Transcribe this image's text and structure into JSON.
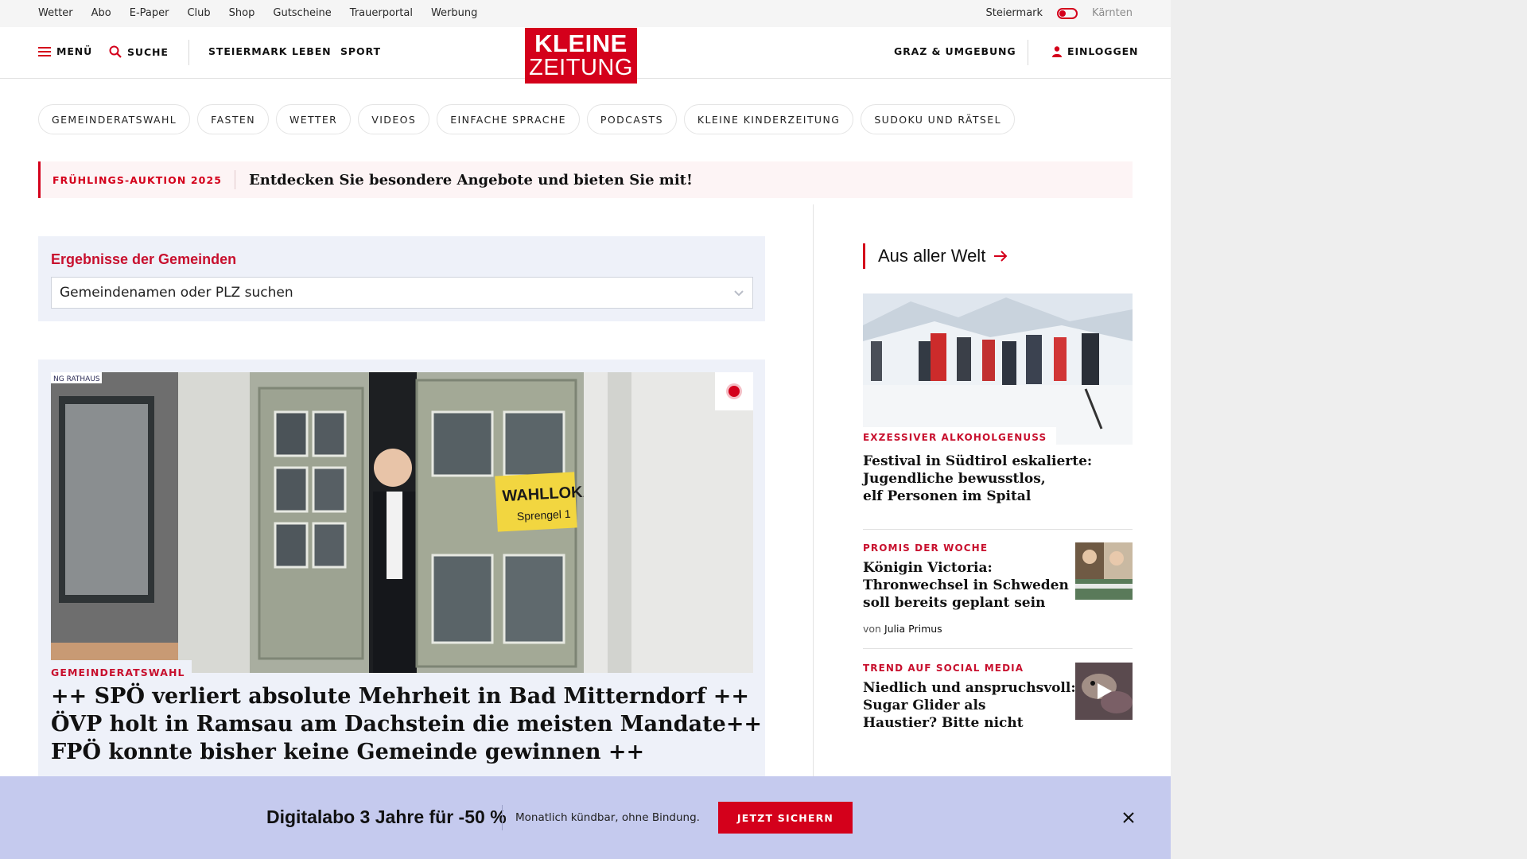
{
  "meta_bar": {
    "links": [
      "Wetter",
      "Abo",
      "E-Paper",
      "Club",
      "Shop",
      "Gutscheine",
      "Trauerportal",
      "Werbung"
    ],
    "region_left": "Steiermark",
    "region_right": "Kärnten"
  },
  "header": {
    "menu_label": "MENÜ",
    "search_label": "SUCHE",
    "nav": [
      "STEIERMARK",
      "LEBEN",
      "SPORT"
    ],
    "logo_line1": "KLEINE",
    "logo_line2": "ZEITUNG",
    "region_link": "GRAZ & UMGEBUNG",
    "login_label": "EINLOGGEN"
  },
  "pills": [
    "GEMEINDERATSWAHL",
    "FASTEN",
    "WETTER",
    "VIDEOS",
    "EINFACHE SPRACHE",
    "PODCASTS",
    "KLEINE KINDERZEITUNG",
    "SUDOKU UND RÄTSEL"
  ],
  "promo": {
    "kicker": "FRÜHLINGS-AUKTION 2025",
    "text": "Entdecken Sie besondere Angebote und bieten Sie mit!"
  },
  "gemeinden": {
    "title": "Ergebnisse der Gemeinden",
    "placeholder": "Gemeindenamen oder PLZ suchen"
  },
  "lead": {
    "image_sign_main": "WAHLLOKAL",
    "image_sign_sub": "Sprengel 1",
    "image_corner_text": "NG RATHAUS",
    "kicker": "GEMEINDERATSWAHL",
    "headline_lines": [
      "++ SPÖ verliert absolute Mehrheit in Bad Mitterndorf ++",
      "ÖVP holt in Ramsau am Dachstein die meisten Mandate++",
      "FPÖ konnte bisher keine Gemeinde gewinnen ++"
    ]
  },
  "sidebar": {
    "section_title": "Aus aller Welt",
    "featured": {
      "kicker": "EXZESSIVER ALKOHOLGENUSS",
      "title_lines": [
        "Festival in Südtirol eskalierte:",
        "Jugendliche bewusstlos,",
        "elf Personen im Spital"
      ]
    },
    "items": [
      {
        "kicker": "PROMIS DER WOCHE",
        "title_lines": [
          "Königin Victoria:",
          "Thronwechsel in Schweden",
          "soll bereits geplant sein"
        ],
        "author_prefix": "von",
        "author": "Julia Primus"
      },
      {
        "kicker": "TREND AUF SOCIAL MEDIA",
        "title_lines": [
          "Niedlich und anspruchsvoll:",
          "Sugar Glider als",
          "Haustier? Bitte nicht"
        ]
      }
    ]
  },
  "subscription": {
    "offer": "Digitalabo 3 Jahre für -50 %",
    "note": "Monatlich kündbar, ohne Bindung.",
    "cta": "JETZT SICHERN"
  },
  "colors": {
    "brand_red": "#d4001b",
    "panel_blue": "#eef1f9",
    "subbar_lavender": "#c5caee"
  }
}
